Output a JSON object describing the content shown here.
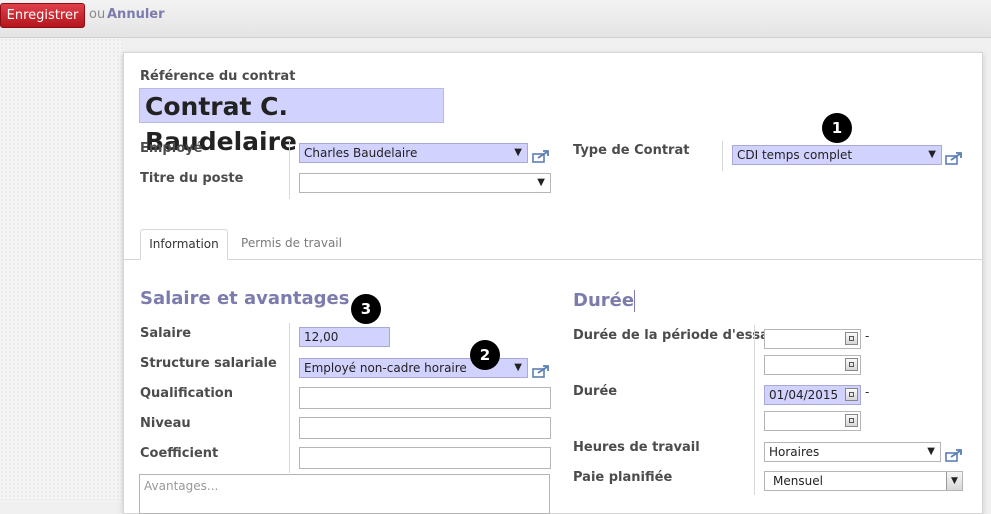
{
  "toolbar": {
    "save_label": "Enregistrer",
    "or_label": "ou",
    "cancel_label": "Annuler"
  },
  "header": {
    "ref_label": "Référence du contrat",
    "ref_value": "Contrat C. Baudelaire"
  },
  "fields_top": {
    "employee_label": "Employé",
    "employee_value": "Charles Baudelaire",
    "job_label": "Titre du poste",
    "job_value": "",
    "type_label": "Type de Contrat",
    "type_value": "CDI temps complet"
  },
  "badges": [
    "1",
    "2",
    "3"
  ],
  "tabs": [
    {
      "label": "Information",
      "active": true
    },
    {
      "label": "Permis de travail",
      "active": false
    }
  ],
  "salary": {
    "title": "Salaire et avantages",
    "salary_label": "Salaire",
    "salary_value": "12,00",
    "structure_label": "Structure salariale",
    "structure_value": "Employé non-cadre horaire",
    "qualification_label": "Qualification",
    "level_label": "Niveau",
    "coefficient_label": "Coefficient",
    "advantages_placeholder": "Avantages..."
  },
  "duration": {
    "title": "Durée",
    "trial_label": "Durée de la période d'essai",
    "trial_start": "",
    "trial_end": "",
    "duration_label": "Durée",
    "start_date": "01/04/2015",
    "end_date": "",
    "dash": "-",
    "hours_label": "Heures de travail",
    "hours_value": "Horaires",
    "pay_label": "Paie planifiée",
    "pay_value": "Mensuel"
  },
  "colors": {
    "accent": "#7c7bad",
    "required_bg": "#d2d2ff",
    "save_button": "#c9232b"
  },
  "icons": [
    "external-link-icon",
    "dropdown-arrow-icon",
    "calendar-icon"
  ]
}
